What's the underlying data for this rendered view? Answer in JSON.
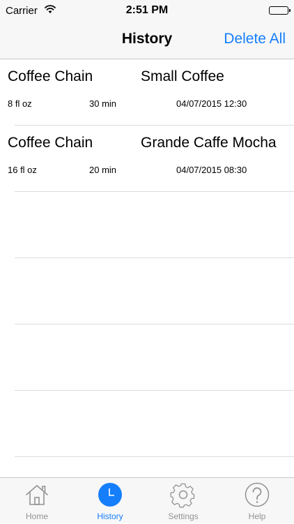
{
  "status_bar": {
    "carrier": "Carrier",
    "time": "2:51 PM"
  },
  "nav": {
    "title": "History",
    "action": "Delete All"
  },
  "history": [
    {
      "chain": "Coffee Chain",
      "drink": "Small Coffee",
      "size": "8 fl oz",
      "duration": "30 min",
      "datetime": "04/07/2015 12:30"
    },
    {
      "chain": "Coffee Chain",
      "drink": "Grande Caffe Mocha",
      "size": "16 fl oz",
      "duration": "20 min",
      "datetime": "04/07/2015 08:30"
    }
  ],
  "tabs": [
    {
      "label": "Home",
      "icon": "home-icon",
      "active": false
    },
    {
      "label": "History",
      "icon": "clock-icon",
      "active": true
    },
    {
      "label": "Settings",
      "icon": "gear-icon",
      "active": false
    },
    {
      "label": "Help",
      "icon": "question-icon",
      "active": false
    }
  ],
  "colors": {
    "accent": "#157efb",
    "inactive": "#929292",
    "bar_background": "#f7f7f7",
    "separator": "#dcdcdc"
  }
}
